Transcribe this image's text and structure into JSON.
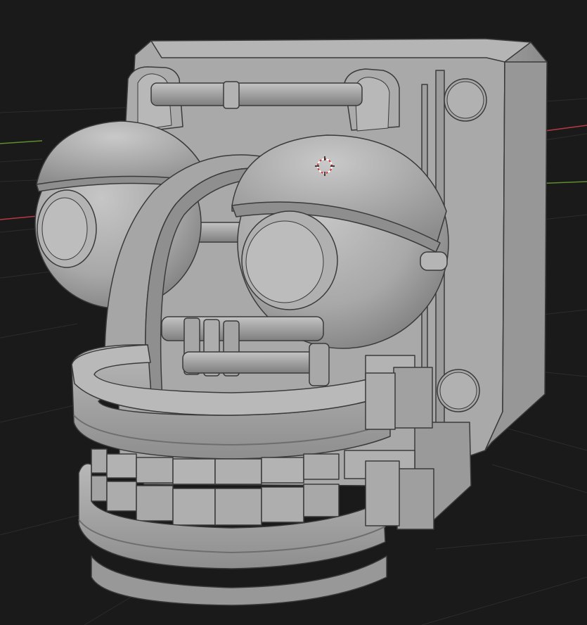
{
  "viewport": {
    "background": "#1a1a1a",
    "grid_color": "#2b2b2b",
    "x_axis_color": "#c3404a",
    "y_axis_color": "#6b9b35",
    "model_base": "#a3a3a3",
    "model_light": "#bdbdbd",
    "model_dark": "#6f6f6f",
    "edge_color": "#3c3c3c"
  },
  "model": {
    "name": "robot-head"
  },
  "cursor": {
    "icon": "3d-cursor-icon",
    "colors": [
      "#d33a3a",
      "#ffffff"
    ]
  }
}
